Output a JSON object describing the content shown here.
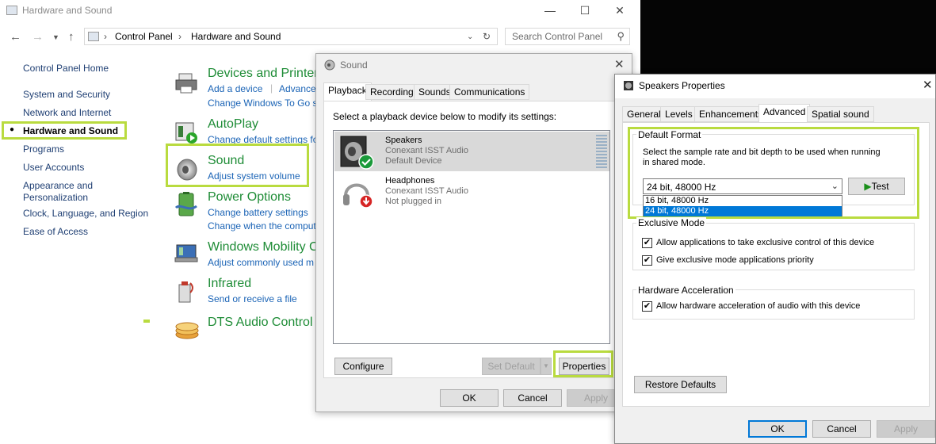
{
  "control_panel": {
    "title": "Hardware and Sound",
    "breadcrumb": [
      "Control Panel",
      "Hardware and Sound"
    ],
    "search_placeholder": "Search Control Panel",
    "sidebar": {
      "items": [
        {
          "label": "Control Panel Home"
        },
        {
          "label": "System and Security"
        },
        {
          "label": "Network and Internet"
        },
        {
          "label": "Hardware and Sound",
          "selected": true
        },
        {
          "label": "Programs"
        },
        {
          "label": "User Accounts"
        },
        {
          "label": "Appearance and Personalization"
        },
        {
          "label": "Clock, Language, and Region"
        },
        {
          "label": "Ease of Access"
        }
      ]
    },
    "categories": [
      {
        "title": "Devices and Printers",
        "links": [
          "Add a device",
          "Advance",
          "Change Windows To Go s"
        ]
      },
      {
        "title": "AutoPlay",
        "links": [
          "Change default settings fo"
        ]
      },
      {
        "title": "Sound",
        "links": [
          "Adjust system volume"
        ]
      },
      {
        "title": "Power Options",
        "links": [
          "Change battery settings",
          "Change when the comput"
        ]
      },
      {
        "title": "Windows Mobility C",
        "links": [
          "Adjust commonly used m"
        ]
      },
      {
        "title": "Infrared",
        "links": [
          "Send or receive a file"
        ]
      },
      {
        "title": "DTS Audio Control P",
        "links": []
      }
    ]
  },
  "sound_dialog": {
    "title": "Sound",
    "tabs": [
      "Playback",
      "Recording",
      "Sounds",
      "Communications"
    ],
    "instruction": "Select a playback device below to modify its settings:",
    "devices": [
      {
        "name": "Speakers",
        "driver": "Conexant ISST Audio",
        "status": "Default Device"
      },
      {
        "name": "Headphones",
        "driver": "Conexant ISST Audio",
        "status": "Not plugged in"
      }
    ],
    "buttons": {
      "configure": "Configure",
      "set_default": "Set Default",
      "properties": "Properties",
      "ok": "OK",
      "cancel": "Cancel",
      "apply": "Apply"
    }
  },
  "speakers_properties": {
    "title": "Speakers Properties",
    "tabs": [
      "General",
      "Levels",
      "Enhancements",
      "Advanced",
      "Spatial sound"
    ],
    "default_format": {
      "label": "Default Format",
      "description_line1": "Select the sample rate and bit depth to be used when running",
      "description_line2": "in shared mode.",
      "selected": "24 bit, 48000 Hz",
      "options": [
        "16 bit, 48000 Hz",
        "24 bit, 48000 Hz"
      ],
      "test_button": "Test"
    },
    "exclusive_mode": {
      "label": "Exclusive Mode",
      "options": [
        {
          "label": "Allow applications to take exclusive control of this device",
          "checked": true
        },
        {
          "label": "Give exclusive mode applications priority",
          "checked": true
        }
      ]
    },
    "hardware_acceleration": {
      "label": "Hardware Acceleration",
      "options": [
        {
          "label": "Allow hardware acceleration of audio with this device",
          "checked": true
        }
      ]
    },
    "buttons": {
      "restore_defaults": "Restore Defaults",
      "ok": "OK",
      "cancel": "Cancel",
      "apply": "Apply"
    }
  },
  "colors": {
    "highlight_box": "#b9db3f",
    "category_title": "#1e8c36",
    "link": "#1b64b6",
    "selection": "#0078d7"
  },
  "icons": [
    "back-arrow-icon",
    "forward-arrow-icon",
    "up-arrow-icon",
    "refresh-icon",
    "search-icon",
    "close-icon",
    "minimize-icon",
    "maximize-icon",
    "speaker-icon",
    "headphones-icon",
    "checkmark-badge-icon",
    "unplugged-badge-icon",
    "play-icon"
  ]
}
